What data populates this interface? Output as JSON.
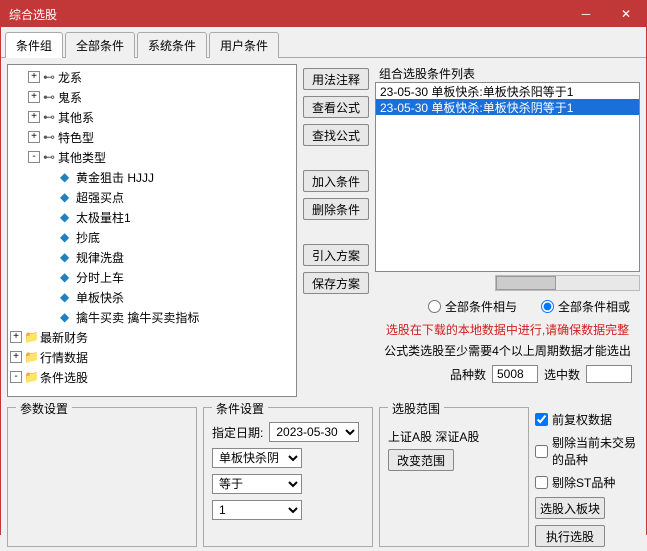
{
  "window": {
    "title": "综合选股"
  },
  "tabs": [
    "条件组",
    "全部条件",
    "系统条件",
    "用户条件"
  ],
  "active_tab": 0,
  "tree": [
    {
      "indent": 1,
      "expander": "+",
      "icon": "link",
      "label": "龙系"
    },
    {
      "indent": 1,
      "expander": "+",
      "icon": "link",
      "label": "鬼系"
    },
    {
      "indent": 1,
      "expander": "+",
      "icon": "link",
      "label": "其他系"
    },
    {
      "indent": 1,
      "expander": "+",
      "icon": "link",
      "label": "特色型"
    },
    {
      "indent": 1,
      "expander": "-",
      "icon": "link",
      "label": "其他类型"
    },
    {
      "indent": 2,
      "expander": "",
      "icon": "diamond",
      "label": "黄金狙击 HJJJ"
    },
    {
      "indent": 2,
      "expander": "",
      "icon": "diamond",
      "label": "超强买点"
    },
    {
      "indent": 2,
      "expander": "",
      "icon": "diamond",
      "label": "太极量柱1"
    },
    {
      "indent": 2,
      "expander": "",
      "icon": "diamond",
      "label": "抄底"
    },
    {
      "indent": 2,
      "expander": "",
      "icon": "diamond",
      "label": "规律洗盘"
    },
    {
      "indent": 2,
      "expander": "",
      "icon": "diamond",
      "label": "分时上车"
    },
    {
      "indent": 2,
      "expander": "",
      "icon": "diamond",
      "label": "单板快杀"
    },
    {
      "indent": 2,
      "expander": "",
      "icon": "diamond",
      "label": "擒牛买卖 擒牛买卖指标"
    },
    {
      "indent": 0,
      "expander": "+",
      "icon": "folder",
      "label": "最新财务"
    },
    {
      "indent": 0,
      "expander": "+",
      "icon": "folder",
      "label": "行情数据"
    },
    {
      "indent": 0,
      "expander": "-",
      "icon": "folder",
      "label": "条件选股"
    }
  ],
  "mid_buttons": {
    "usage": "用法注释",
    "view_formula": "查看公式",
    "find_formula": "查找公式",
    "add_cond": "加入条件",
    "del_cond": "删除条件",
    "import_plan": "引入方案",
    "save_plan": "保存方案"
  },
  "list": {
    "label": "组合选股条件列表",
    "items": [
      "23-05-30 单板快杀:单板快杀阳等于1",
      "23-05-30 单板快杀:单板快杀阴等于1"
    ],
    "selected": 1
  },
  "radios": {
    "and": "全部条件相与",
    "or": "全部条件相或",
    "selected": "or"
  },
  "warn_text": "选股在下载的本地数据中进行,请确保数据完整",
  "info_text": "公式类选股至少需要4个以上周期数据才能选出",
  "counts": {
    "variety_label": "品种数",
    "variety_value": "5008",
    "selected_label": "选中数",
    "selected_value": ""
  },
  "groups": {
    "params": "参数设置",
    "cond": "条件设置",
    "scope": "选股范围"
  },
  "cond_settings": {
    "date_label": "指定日期:",
    "date_value": "2023-05-30",
    "field": "单板快杀阴",
    "op": "等于",
    "value": "1"
  },
  "scope": {
    "text": "上证A股 深证A股",
    "change": "改变范围"
  },
  "opts": {
    "fq": "前复权数据",
    "skip_no_trade": "剔除当前未交易的品种",
    "skip_st": "剔除ST品种",
    "to_block": "选股入板块",
    "run": "执行选股",
    "fq_checked": true,
    "skip_no_trade_checked": false,
    "skip_st_checked": false
  }
}
